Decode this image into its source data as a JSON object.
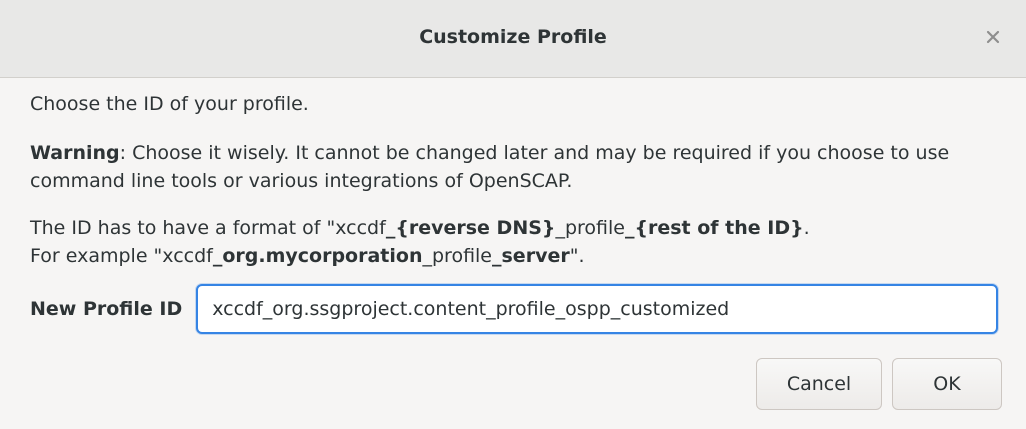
{
  "window": {
    "title": "Customize Profile",
    "close_icon": "close-icon"
  },
  "intro": {
    "text": "Choose the ID of your profile."
  },
  "warning": {
    "label": "Warning",
    "text": ": Choose it wisely. It cannot be changed later and may be required if you choose to use command line tools or various integrations of OpenSCAP."
  },
  "format_info": {
    "line1_prefix": "The ID has to have a format of \"xccdf",
    "line1_bold1": "_{reverse DNS}",
    "line1_mid": "_profile",
    "line1_bold2": "_{rest of the ID}",
    "line1_suffix": ".",
    "line2_prefix": "For example \"xccdf",
    "line2_bold1": "_org.mycorporation",
    "line2_mid": "_profile",
    "line2_bold2": "_server",
    "line2_suffix": "\"."
  },
  "profile_id": {
    "label": "New Profile ID",
    "value": "xccdf_org.ssgproject.content_profile_ospp_customized"
  },
  "buttons": {
    "cancel": "Cancel",
    "ok": "OK"
  }
}
